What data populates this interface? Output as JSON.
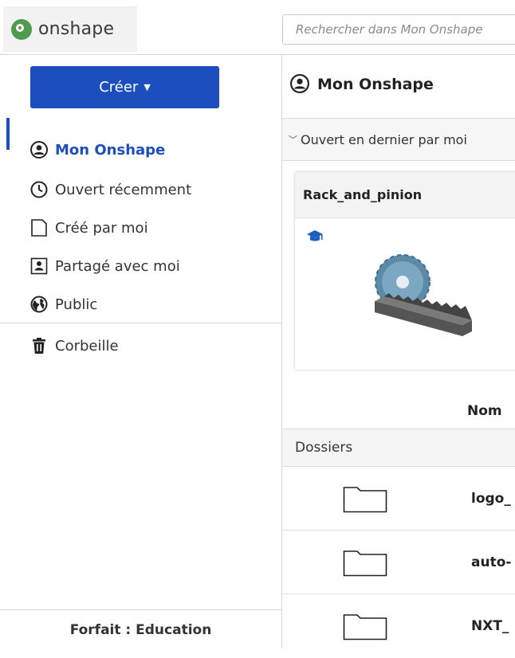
{
  "app": {
    "logo_text": "onshape",
    "search_placeholder": "Rechercher dans Mon Onshape"
  },
  "sidebar": {
    "create_label": "Créer",
    "items": [
      {
        "label": "Mon Onshape",
        "icon": "user-circle-icon",
        "active": true
      },
      {
        "label": "Ouvert récemment",
        "icon": "clock-icon"
      },
      {
        "label": "Créé par moi",
        "icon": "document-icon"
      },
      {
        "label": "Partagé avec moi",
        "icon": "shared-user-icon"
      },
      {
        "label": "Public",
        "icon": "globe-icon"
      },
      {
        "label": "Corbeille",
        "icon": "trash-icon"
      }
    ],
    "plan_label": "Forfait : Education"
  },
  "main": {
    "title": "Mon Onshape",
    "recent_header": "Ouvert en dernier par moi",
    "recent_card": {
      "name": "Rack_and_pinion",
      "badge_icon": "education-cap-icon"
    },
    "column_name": "Nom",
    "folders_label": "Dossiers",
    "folders": [
      {
        "name": "logo_",
        "icon": "folder-icon"
      },
      {
        "name": "auto-",
        "icon": "folder-icon"
      },
      {
        "name": "NXT_",
        "icon": "folder-icon"
      }
    ]
  },
  "colors": {
    "accent": "#1c4fbd",
    "logo_green": "#4e9a4e"
  }
}
